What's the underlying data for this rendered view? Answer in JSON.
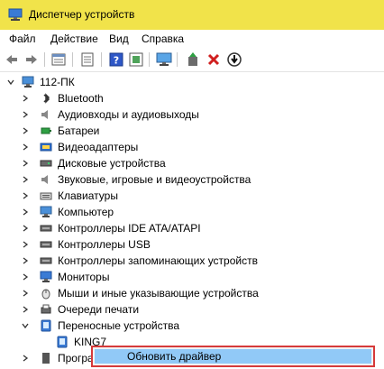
{
  "window": {
    "title": "Диспетчер устройств",
    "title_bar_color": "#f1e34a"
  },
  "menu": {
    "items": [
      "Файл",
      "Действие",
      "Вид",
      "Справка"
    ]
  },
  "toolbar": {
    "buttons": [
      "back-icon",
      "forward-icon",
      "properties-icon",
      "list-icon",
      "help-icon",
      "view-icon",
      "monitor-icon",
      "update-driver-icon",
      "remove-icon",
      "download-icon"
    ]
  },
  "tree": {
    "root": "112-ПК",
    "categories": [
      "Bluetooth",
      "Аудиовходы и аудиовыходы",
      "Батареи",
      "Видеоадаптеры",
      "Дисковые устройства",
      "Звуковые, игровые и видеоустройства",
      "Клавиатуры",
      "Компьютер",
      "Контроллеры IDE ATA/ATAPI",
      "Контроллеры USB",
      "Контроллеры запоминающих устройств",
      "Мониторы",
      "Мыши и иные указывающие устройства",
      "Очереди печати",
      "Переносные устройства"
    ],
    "expanded_child": "KING7",
    "partial_next": "Програ"
  },
  "context_menu": {
    "item": "Обновить драйвер",
    "highlight_color": "#91c9f7",
    "border_color": "#d63a3a"
  }
}
